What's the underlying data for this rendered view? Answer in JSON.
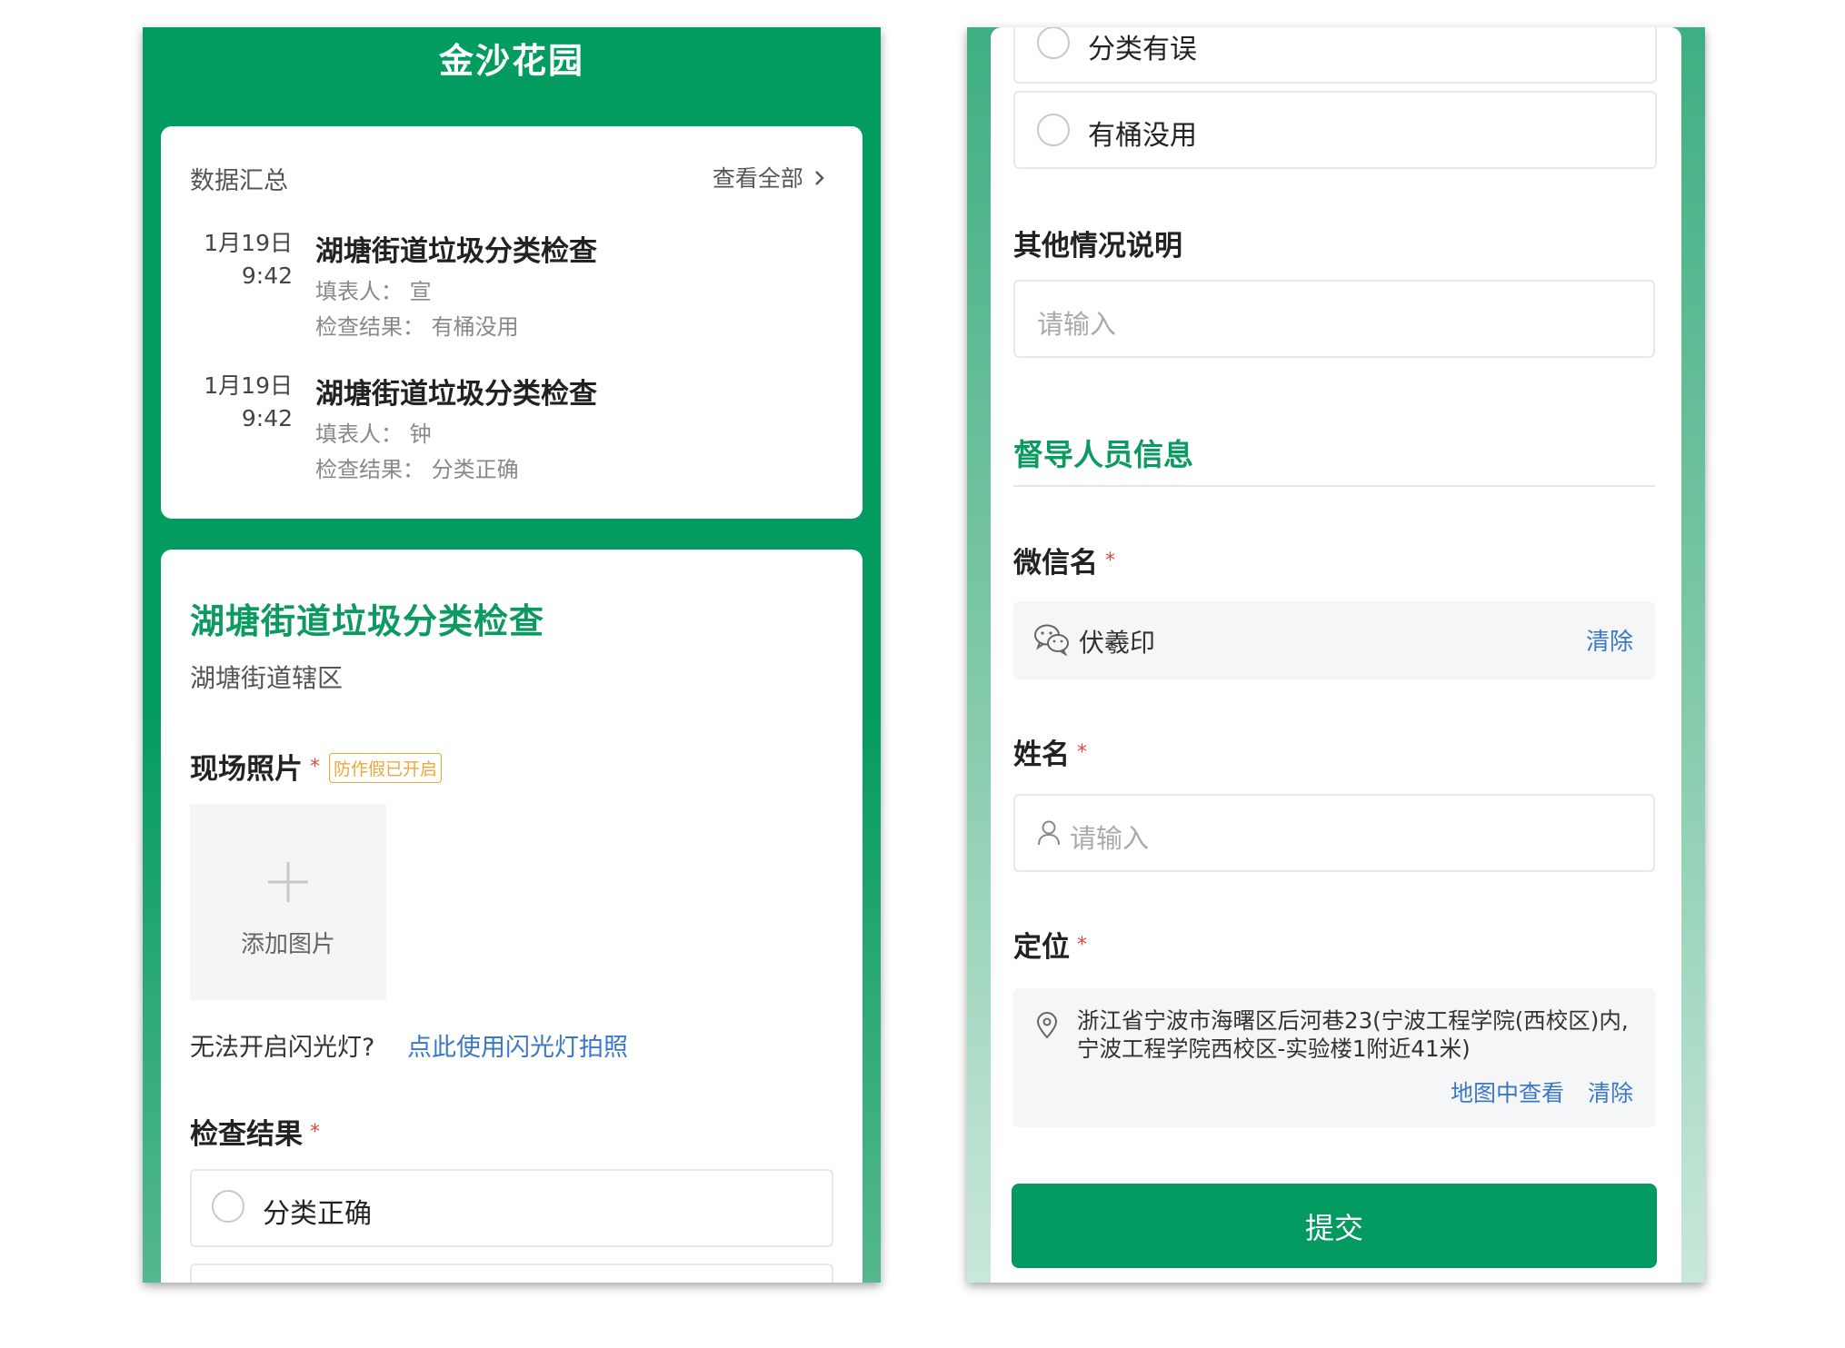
{
  "left": {
    "header": {
      "title": "金沙花园"
    },
    "summary": {
      "heading": "数据汇总",
      "view_all": "查看全部",
      "records": [
        {
          "date": "1月19日",
          "time": "9:42",
          "title": "湖塘街道垃圾分类检查",
          "filler": "填表人： 宣",
          "result": "检查结果： 有桶没用"
        },
        {
          "date": "1月19日",
          "time": "9:42",
          "title": "湖塘街道垃圾分类检查",
          "filler": "填表人： 钟",
          "result": "检查结果： 分类正确"
        }
      ]
    },
    "form": {
      "title": "湖塘街道垃圾分类检查",
      "district": "湖塘街道辖区",
      "photo_label": "现场照片",
      "anti_fake_badge": "防作假已开启",
      "add_image": "添加图片",
      "flash_question": "无法开启闪光灯?",
      "flash_link": "点此使用闪光灯拍照",
      "result_label": "检查结果",
      "options": [
        "分类正确"
      ]
    }
  },
  "right": {
    "options": [
      "分类有误",
      "有桶没用"
    ],
    "other_label": "其他情况说明",
    "other_placeholder": "请输入",
    "supervisor_section": "督导人员信息",
    "wechat_label": "微信名",
    "wechat_value": "伏羲印",
    "clear": "清除",
    "name_label": "姓名",
    "name_placeholder": "请输入",
    "location_label": "定位",
    "location_value": "浙江省宁波市海曙区后河巷23(宁波工程学院(西校区)内,宁波工程学院西校区-实验楼1附近41米)",
    "view_on_map": "地图中查看",
    "submit": "提交"
  },
  "required_mark": "*",
  "colors": {
    "brand_green": "#039a61",
    "link_blue": "#3a78c7",
    "badge_orange": "#f0a63c",
    "required_red": "#e2483d"
  }
}
